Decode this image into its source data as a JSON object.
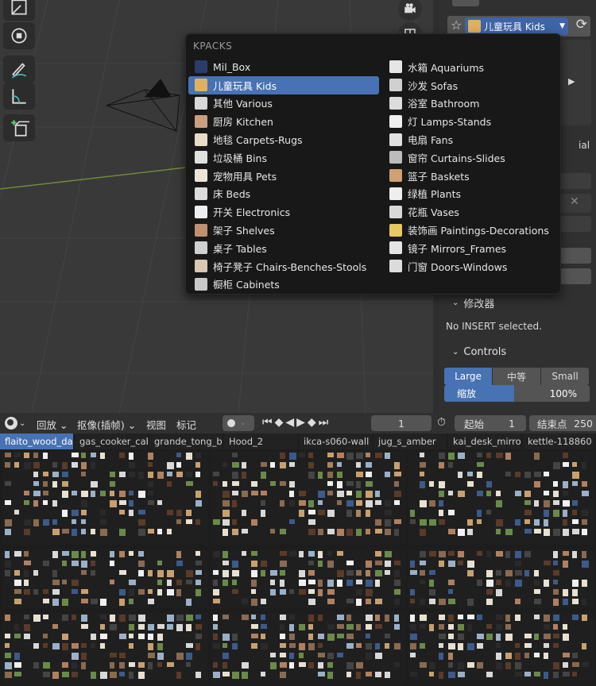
{
  "menu": {
    "title": "KPACKS",
    "left_items": [
      {
        "label": "Mil_Box",
        "thumb": "#2a3d6a"
      },
      {
        "label": "儿童玩具 Kids",
        "thumb": "#e0b060",
        "active": true
      },
      {
        "label": "其他 Various",
        "thumb": "#d8d8d8"
      },
      {
        "label": "厨房 Kitchen",
        "thumb": "#c8a080"
      },
      {
        "label": "地毯 Carpets-Rugs",
        "thumb": "#e8dcc8"
      },
      {
        "label": "垃圾桶 Bins",
        "thumb": "#e0e0e0"
      },
      {
        "label": "宠物用具 Pets",
        "thumb": "#ece4d8"
      },
      {
        "label": "床 Beds",
        "thumb": "#dcdcdc"
      },
      {
        "label": "开关 Electronics",
        "thumb": "#eeeeee"
      },
      {
        "label": "架子 Shelves",
        "thumb": "#c09070"
      },
      {
        "label": "桌子 Tables",
        "thumb": "#d0d0d0"
      },
      {
        "label": "椅子凳子 Chairs-Benches-Stools",
        "thumb": "#d8c8b0"
      },
      {
        "label": "橱柜 Cabinets",
        "thumb": "#c8c8c8"
      }
    ],
    "right_items": [
      {
        "label": "水箱 Aquariums",
        "thumb": "#e6e6e6"
      },
      {
        "label": "沙发 Sofas",
        "thumb": "#d0d0d0"
      },
      {
        "label": "浴室 Bathroom",
        "thumb": "#dcdcdc"
      },
      {
        "label": "灯 Lamps-Stands",
        "thumb": "#f0f0f0"
      },
      {
        "label": "电扇 Fans",
        "thumb": "#e0e0e0"
      },
      {
        "label": "窗帘 Curtains-Slides",
        "thumb": "#bcbcbc"
      },
      {
        "label": "篮子 Baskets",
        "thumb": "#d0a070"
      },
      {
        "label": "绿植 Plants",
        "thumb": "#eeeeee"
      },
      {
        "label": "花瓶 Vases",
        "thumb": "#d8d8d8"
      },
      {
        "label": "装饰画 Paintings-Decorations",
        "thumb": "#e8c860"
      },
      {
        "label": "镜子 Mirrors_Frames",
        "thumb": "#e4e4e4"
      },
      {
        "label": "门窗 Doors-Windows",
        "thumb": "#dcdcdc"
      }
    ]
  },
  "right_panel": {
    "selected_pack": "儿童玩具 Kids",
    "partial_text": "ial",
    "modifier_header": "修改器",
    "no_insert_msg": "No INSERT selected.",
    "controls_header": "Controls",
    "sizes": [
      "Large",
      "中等",
      "Small"
    ],
    "selected_size": "Large",
    "scale_label": "缩放",
    "scale_value": "100%",
    "scale_fraction": 0.48
  },
  "timeline": {
    "playback": "回放",
    "keying": "抠像(插帧)",
    "view": "视图",
    "marker": "标记",
    "current_frame": "1",
    "start_label": "起始",
    "start_value": "1",
    "end_label": "结束点",
    "end_value": "250"
  },
  "assets": {
    "tabs": [
      "flaito_wood_da",
      "gas_cooker_cab",
      "grande_tong_bu",
      "Hood_2",
      "ikca-s060-wall",
      "jug_s_amber",
      "kai_desk_mirro",
      "kettle-118860"
    ]
  },
  "colors": {
    "accent": "#4772b3",
    "menu_bg": "#181818",
    "viewport_bg": "#393939"
  }
}
